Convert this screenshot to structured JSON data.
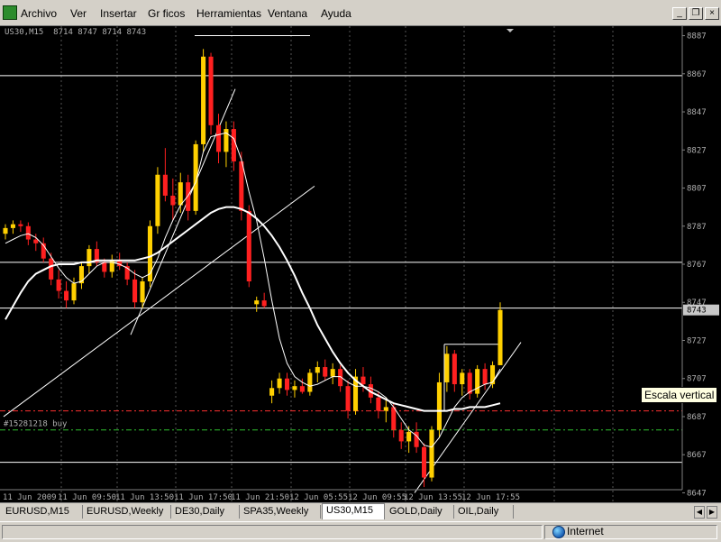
{
  "menu": [
    "Archivo",
    "Ver",
    "Insertar",
    "Gr ficos",
    "Herramientas",
    "Ventana",
    "Ayuda"
  ],
  "window_buttons": {
    "minimize": "_",
    "restore": "❐",
    "close": "×"
  },
  "chart": {
    "header": "US30,M15  8714 8747 8714 8743",
    "order_label": "#15281218 buy",
    "current_price_label": "8743",
    "tooltip": "Escala vertical",
    "price_ticks": [
      "8887",
      "8867",
      "8847",
      "8827",
      "8807",
      "8787",
      "8767",
      "8747",
      "8727",
      "8707",
      "8687",
      "8667",
      "8647"
    ],
    "time_ticks": [
      "11 Jun 2009",
      "11 Jun 09:50",
      "11 Jun 13:50",
      "11 Jun 17:50",
      "11 Jun 21:50",
      "12 Jun 05:55",
      "12 Jun 09:55",
      "12 Jun 13:55",
      "12 Jun 17:55"
    ],
    "colors": {
      "background": "#000000",
      "bull": "#ffd000",
      "bear": "#ff2020",
      "ma": "#ffffff",
      "grid": "#555555",
      "order": "#ff3030",
      "tp": "#30c030"
    }
  },
  "chart_data": {
    "type": "candlestick",
    "symbol": "US30",
    "timeframe": "M15",
    "ylim": [
      8642,
      8892
    ],
    "horizontal_levels": [
      8866,
      8768,
      8744,
      8725,
      8690,
      8680,
      8663
    ],
    "order_level": 8690,
    "tp_level": 8680,
    "candles": [
      {
        "o": 8783,
        "h": 8788,
        "l": 8780,
        "c": 8786
      },
      {
        "o": 8786,
        "h": 8790,
        "l": 8783,
        "c": 8788
      },
      {
        "o": 8788,
        "h": 8790,
        "l": 8784,
        "c": 8787
      },
      {
        "o": 8787,
        "h": 8789,
        "l": 8777,
        "c": 8780
      },
      {
        "o": 8780,
        "h": 8783,
        "l": 8774,
        "c": 8778
      },
      {
        "o": 8778,
        "h": 8781,
        "l": 8768,
        "c": 8770
      },
      {
        "o": 8770,
        "h": 8773,
        "l": 8756,
        "c": 8759
      },
      {
        "o": 8759,
        "h": 8764,
        "l": 8749,
        "c": 8753
      },
      {
        "o": 8753,
        "h": 8758,
        "l": 8744,
        "c": 8748
      },
      {
        "o": 8748,
        "h": 8760,
        "l": 8746,
        "c": 8757
      },
      {
        "o": 8757,
        "h": 8768,
        "l": 8754,
        "c": 8766
      },
      {
        "o": 8766,
        "h": 8777,
        "l": 8762,
        "c": 8775
      },
      {
        "o": 8775,
        "h": 8779,
        "l": 8766,
        "c": 8768
      },
      {
        "o": 8768,
        "h": 8770,
        "l": 8760,
        "c": 8763
      },
      {
        "o": 8763,
        "h": 8772,
        "l": 8760,
        "c": 8769
      },
      {
        "o": 8769,
        "h": 8773,
        "l": 8764,
        "c": 8766
      },
      {
        "o": 8766,
        "h": 8768,
        "l": 8756,
        "c": 8759
      },
      {
        "o": 8759,
        "h": 8764,
        "l": 8744,
        "c": 8747
      },
      {
        "o": 8747,
        "h": 8760,
        "l": 8744,
        "c": 8758
      },
      {
        "o": 8758,
        "h": 8790,
        "l": 8755,
        "c": 8787
      },
      {
        "o": 8787,
        "h": 8818,
        "l": 8783,
        "c": 8814
      },
      {
        "o": 8814,
        "h": 8828,
        "l": 8800,
        "c": 8803
      },
      {
        "o": 8803,
        "h": 8812,
        "l": 8790,
        "c": 8798
      },
      {
        "o": 8798,
        "h": 8815,
        "l": 8794,
        "c": 8810
      },
      {
        "o": 8810,
        "h": 8814,
        "l": 8790,
        "c": 8795
      },
      {
        "o": 8795,
        "h": 8832,
        "l": 8793,
        "c": 8830
      },
      {
        "o": 8830,
        "h": 8880,
        "l": 8826,
        "c": 8876
      },
      {
        "o": 8876,
        "h": 8878,
        "l": 8835,
        "c": 8840
      },
      {
        "o": 8840,
        "h": 8846,
        "l": 8820,
        "c": 8826
      },
      {
        "o": 8826,
        "h": 8842,
        "l": 8818,
        "c": 8838
      },
      {
        "o": 8838,
        "h": 8842,
        "l": 8816,
        "c": 8821
      },
      {
        "o": 8821,
        "h": 8826,
        "l": 8790,
        "c": 8795
      },
      {
        "o": 8795,
        "h": 8798,
        "l": 8755,
        "c": 8758
      },
      {
        "o": 8746,
        "h": 8750,
        "l": 8742,
        "c": 8748
      },
      {
        "o": 8748,
        "h": 8752,
        "l": 8744,
        "c": 8745
      },
      {
        "o": 8698,
        "h": 8706,
        "l": 8694,
        "c": 8702
      },
      {
        "o": 8702,
        "h": 8710,
        "l": 8699,
        "c": 8707
      },
      {
        "o": 8707,
        "h": 8710,
        "l": 8698,
        "c": 8701
      },
      {
        "o": 8701,
        "h": 8706,
        "l": 8697,
        "c": 8703
      },
      {
        "o": 8703,
        "h": 8707,
        "l": 8699,
        "c": 8700
      },
      {
        "o": 8700,
        "h": 8712,
        "l": 8698,
        "c": 8710
      },
      {
        "o": 8710,
        "h": 8716,
        "l": 8705,
        "c": 8713
      },
      {
        "o": 8713,
        "h": 8717,
        "l": 8706,
        "c": 8708
      },
      {
        "o": 8708,
        "h": 8715,
        "l": 8704,
        "c": 8712
      },
      {
        "o": 8712,
        "h": 8714,
        "l": 8700,
        "c": 8703
      },
      {
        "o": 8703,
        "h": 8706,
        "l": 8686,
        "c": 8690
      },
      {
        "o": 8690,
        "h": 8712,
        "l": 8688,
        "c": 8708
      },
      {
        "o": 8708,
        "h": 8713,
        "l": 8700,
        "c": 8704
      },
      {
        "o": 8704,
        "h": 8708,
        "l": 8694,
        "c": 8697
      },
      {
        "o": 8697,
        "h": 8700,
        "l": 8686,
        "c": 8690
      },
      {
        "o": 8690,
        "h": 8697,
        "l": 8684,
        "c": 8692
      },
      {
        "o": 8692,
        "h": 8694,
        "l": 8676,
        "c": 8680
      },
      {
        "o": 8680,
        "h": 8684,
        "l": 8670,
        "c": 8674
      },
      {
        "o": 8674,
        "h": 8682,
        "l": 8668,
        "c": 8679
      },
      {
        "o": 8679,
        "h": 8684,
        "l": 8668,
        "c": 8671
      },
      {
        "o": 8671,
        "h": 8673,
        "l": 8650,
        "c": 8655
      },
      {
        "o": 8655,
        "h": 8682,
        "l": 8653,
        "c": 8680
      },
      {
        "o": 8680,
        "h": 8710,
        "l": 8676,
        "c": 8705
      },
      {
        "o": 8705,
        "h": 8724,
        "l": 8700,
        "c": 8720
      },
      {
        "o": 8720,
        "h": 8722,
        "l": 8700,
        "c": 8704
      },
      {
        "o": 8704,
        "h": 8712,
        "l": 8698,
        "c": 8710
      },
      {
        "o": 8710,
        "h": 8712,
        "l": 8696,
        "c": 8699
      },
      {
        "o": 8699,
        "h": 8714,
        "l": 8697,
        "c": 8712
      },
      {
        "o": 8712,
        "h": 8715,
        "l": 8701,
        "c": 8704
      },
      {
        "o": 8704,
        "h": 8716,
        "l": 8702,
        "c": 8714
      },
      {
        "o": 8714,
        "h": 8747,
        "l": 8714,
        "c": 8743
      }
    ],
    "ma_fast": [
      8778,
      8780,
      8782,
      8783,
      8781,
      8777,
      8771,
      8765,
      8760,
      8757,
      8758,
      8762,
      8766,
      8768,
      8768,
      8767,
      8765,
      8762,
      8760,
      8762,
      8770,
      8781,
      8790,
      8798,
      8803,
      8810,
      8826,
      8834,
      8835,
      8836,
      8833,
      8822,
      8805,
      8790,
      8770,
      8748,
      8728,
      8715,
      8708,
      8705,
      8703,
      8704,
      8706,
      8708,
      8708,
      8705,
      8703,
      8703,
      8702,
      8700,
      8697,
      8692,
      8686,
      8680,
      8677,
      8672,
      8671,
      8676,
      8684,
      8692,
      8697,
      8700,
      8702,
      8704,
      8705,
      8712
    ],
    "ma_slow": [
      8738,
      8745,
      8752,
      8758,
      8762,
      8764,
      8766,
      8767,
      8767,
      8767,
      8768,
      8768,
      8769,
      8769,
      8769,
      8769,
      8769,
      8769,
      8770,
      8771,
      8773,
      8776,
      8779,
      8782,
      8785,
      8788,
      8791,
      8794,
      8796,
      8797,
      8797,
      8796,
      8794,
      8791,
      8787,
      8782,
      8776,
      8769,
      8761,
      8752,
      8744,
      8735,
      8728,
      8721,
      8715,
      8710,
      8706,
      8703,
      8700,
      8698,
      8696,
      8694,
      8693,
      8692,
      8691,
      8690,
      8690,
      8690,
      8690,
      8691,
      8691,
      8692,
      8692,
      8692,
      8693,
      8694
    ]
  },
  "tabs": [
    "EURUSD,M15",
    "EURUSD,Weekly",
    "DE30,Daily",
    "SPA35,Weekly",
    "US30,M15",
    "GOLD,Daily",
    "OIL,Daily"
  ],
  "active_tab": "US30,M15",
  "status": {
    "zone": "Internet"
  }
}
